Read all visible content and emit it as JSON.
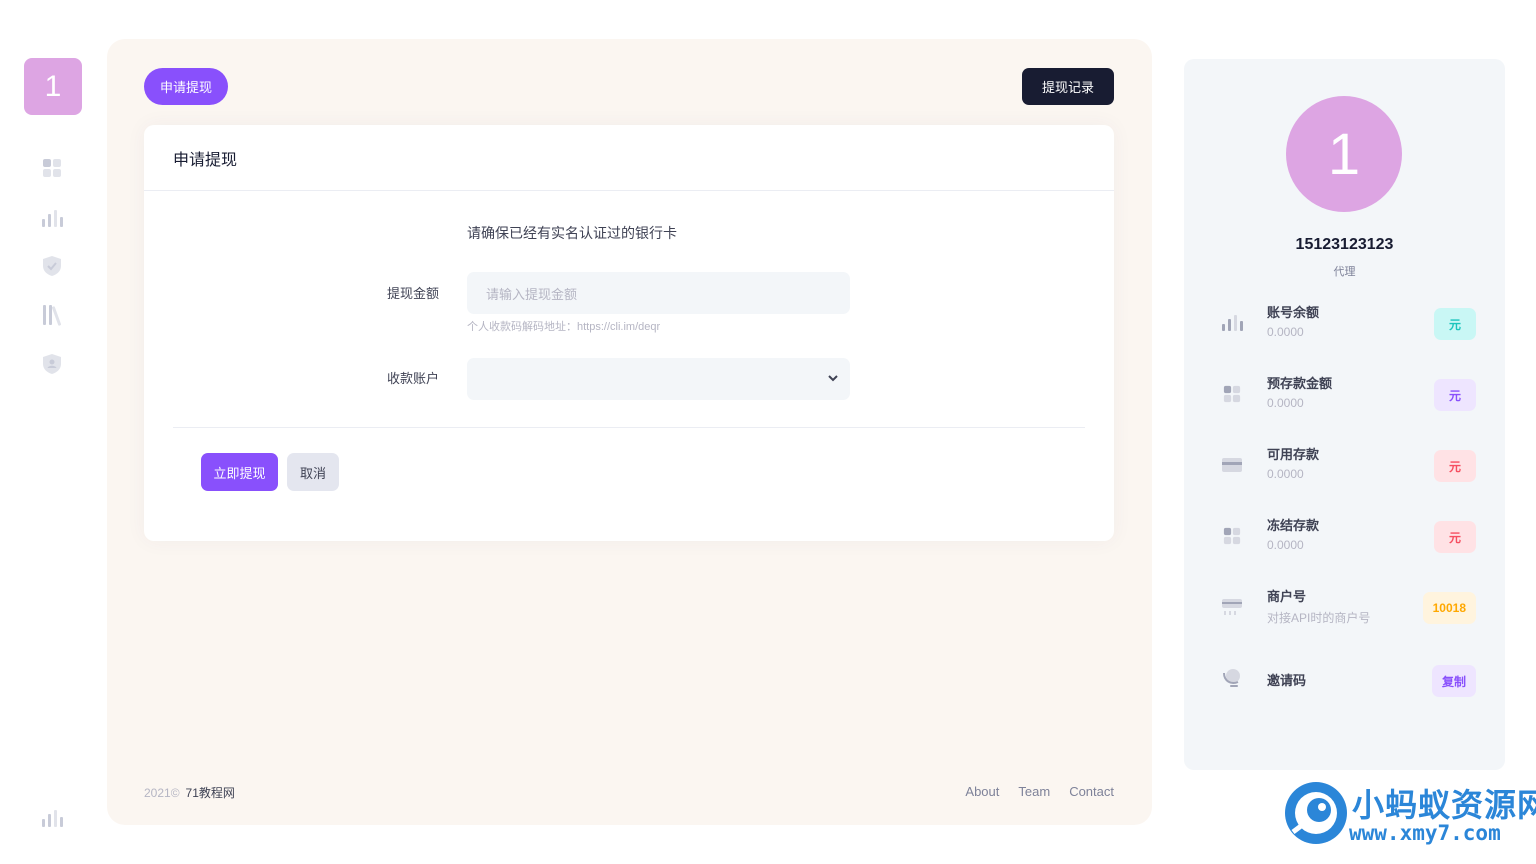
{
  "rail": {
    "logo": "1",
    "icons": [
      "dashboard-icon",
      "bar-chart-icon",
      "shield-check-icon",
      "library-icon",
      "shield-user-icon",
      "bar-chart-icon"
    ]
  },
  "toolbar": {
    "apply_label": "申请提现",
    "record_label": "提现记录"
  },
  "card": {
    "title": "申请提现",
    "notice": "请确保已经有实名认证过的银行卡",
    "amount_label": "提现金额",
    "amount_placeholder": "请输入提现金额",
    "hint": "个人收款码解码地址：https://cli.im/deqr",
    "account_label": "收款账户",
    "account_value": "",
    "submit_label": "立即提现",
    "cancel_label": "取消"
  },
  "footer": {
    "year": "2021©",
    "brand": "71教程网",
    "links": [
      "About",
      "Team",
      "Contact"
    ]
  },
  "profile": {
    "avatar": "1",
    "name": "15123123123",
    "role": "代理",
    "stats": [
      {
        "icon": "bar-chart-icon",
        "title": "账号余额",
        "sub": "0.0000",
        "badge": "元",
        "badge_bg": "#c9f7f5",
        "badge_fg": "#1bc5bd"
      },
      {
        "icon": "dashboard-icon",
        "title": "预存款金额",
        "sub": "0.0000",
        "badge": "元",
        "badge_bg": "#eee5ff",
        "badge_fg": "#8950fc"
      },
      {
        "icon": "credit-card-icon",
        "title": "可用存款",
        "sub": "0.0000",
        "badge": "元",
        "badge_bg": "#ffe2e5",
        "badge_fg": "#f64e60"
      },
      {
        "icon": "dashboard-icon",
        "title": "冻结存款",
        "sub": "0.0000",
        "badge": "元",
        "badge_bg": "#ffe2e5",
        "badge_fg": "#f64e60"
      },
      {
        "icon": "terminal-icon",
        "title": "商户号",
        "sub": "对接API时的商户号",
        "badge": "10018",
        "badge_bg": "#fff4de",
        "badge_fg": "#ffa800"
      },
      {
        "icon": "globe-icon",
        "title": "邀请码",
        "sub": "",
        "badge": "复制",
        "badge_bg": "#eee5ff",
        "badge_fg": "#8950fc"
      }
    ]
  },
  "watermark": {
    "cn": "小蚂蚁资源网",
    "url": "www.xmy7.com"
  },
  "colors": {
    "primary": "#8950fc",
    "dark": "#181c32",
    "main_bg": "#fbf6f1",
    "avatar": "#dda5e3"
  }
}
